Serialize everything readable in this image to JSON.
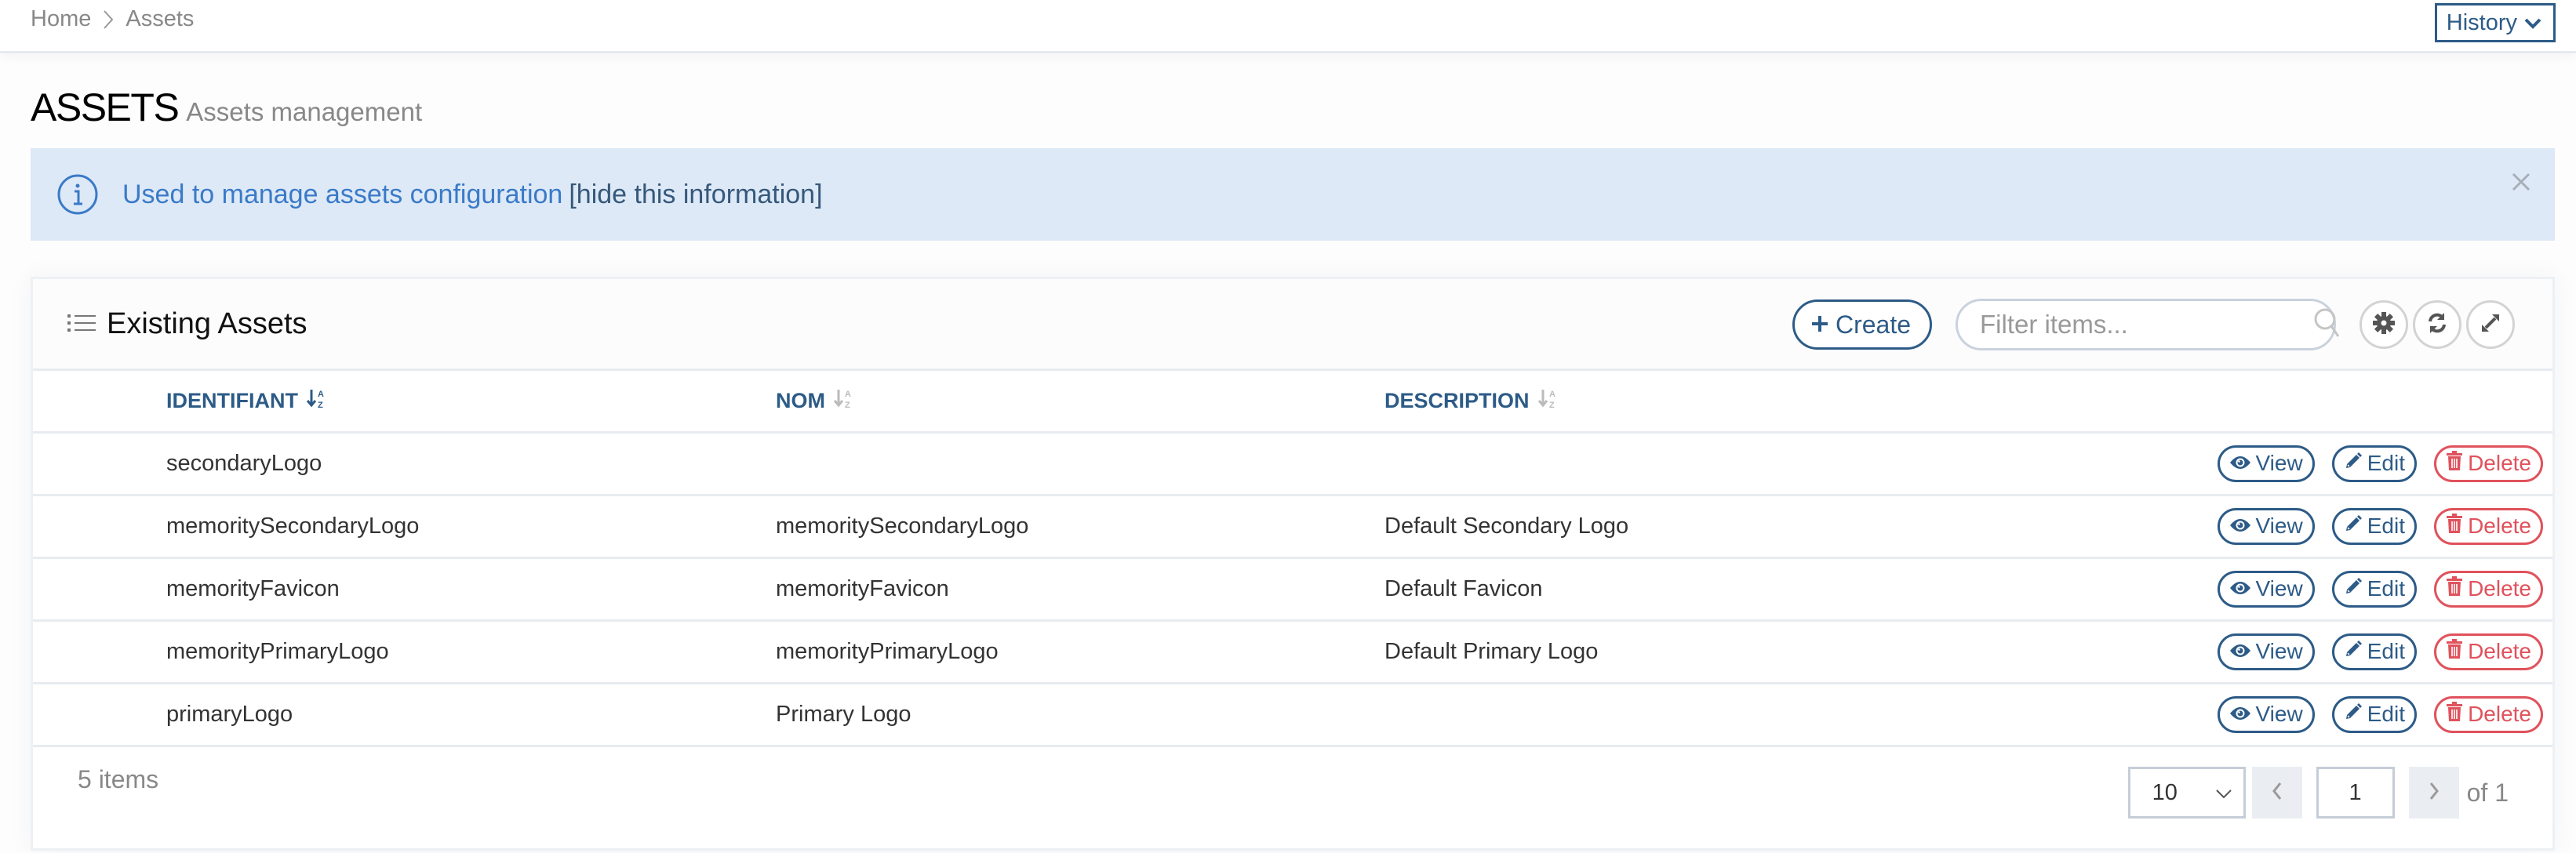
{
  "breadcrumb": {
    "items": [
      "Home",
      "Assets"
    ]
  },
  "header": {
    "history_label": "History"
  },
  "page": {
    "title": "ASSETS",
    "subtitle": "Assets management"
  },
  "info_banner": {
    "text": "Used to manage assets configuration",
    "hide_link": "[hide this information]",
    "close_icon": "close-icon",
    "icon": "info-icon"
  },
  "card": {
    "title": "Existing Assets",
    "create_label": "Create",
    "filter_placeholder": "Filter items...",
    "toolbar_icons": [
      "gear-icon",
      "refresh-icon",
      "expand-icon"
    ]
  },
  "table": {
    "columns": [
      "IDENTIFIANT",
      "NOM",
      "DESCRIPTION"
    ],
    "sort_active_column": "IDENTIFIANT",
    "rows": [
      {
        "id": "secondaryLogo",
        "nom": "",
        "description": ""
      },
      {
        "id": "memoritySecondaryLogo",
        "nom": "memoritySecondaryLogo",
        "description": "Default Secondary Logo"
      },
      {
        "id": "memorityFavicon",
        "nom": "memorityFavicon",
        "description": "Default Favicon"
      },
      {
        "id": "memorityPrimaryLogo",
        "nom": "memorityPrimaryLogo",
        "description": "Default Primary Logo"
      },
      {
        "id": "primaryLogo",
        "nom": "Primary Logo",
        "description": ""
      }
    ],
    "actions": {
      "view": "View",
      "edit": "Edit",
      "delete": "Delete"
    }
  },
  "footer": {
    "items_count": "5 items",
    "page_size": "10",
    "current_page": "1",
    "of_pages": "of 1"
  },
  "colors": {
    "primary": "#2d5b87",
    "danger": "#e0525c",
    "info_bg": "#dde9f7",
    "info_text": "#3a7ac7"
  }
}
